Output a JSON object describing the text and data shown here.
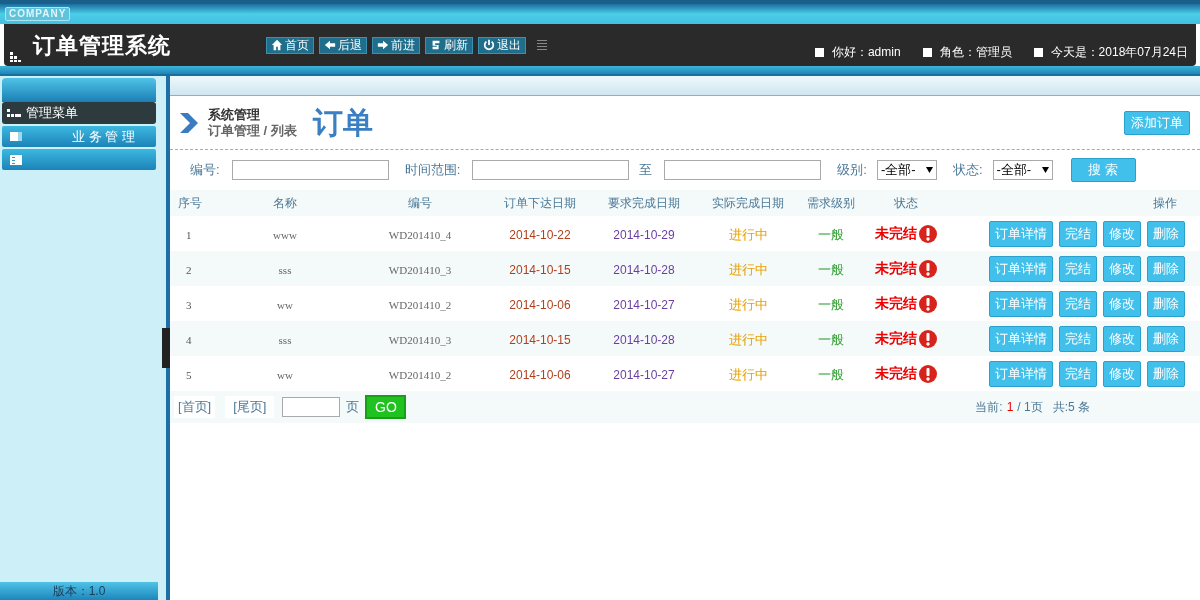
{
  "company": "COMPANY",
  "app_title": "订单管理系统",
  "nav": [
    {
      "kind": "home",
      "label": "首页"
    },
    {
      "kind": "back",
      "label": "后退"
    },
    {
      "kind": "forward",
      "label": "前进"
    },
    {
      "kind": "refresh",
      "label": "刷新"
    },
    {
      "kind": "power",
      "label": "退出"
    }
  ],
  "user_info": [
    "你好：admin",
    "角色：管理员",
    "今天是：2018年07月24日"
  ],
  "sidebar": {
    "title": "管理菜单",
    "items": [
      {
        "kind": "section",
        "label": "业 务 管 理"
      },
      {
        "kind": "blank"
      }
    ],
    "footer": "版本：1.0"
  },
  "breadcrumb": {
    "section": "系统管理",
    "path": "订单管理 / 列表",
    "page_title": "订单"
  },
  "add_button": "添加订单",
  "filters": {
    "fields": [
      {
        "kind": "text",
        "label": "编号:"
      },
      {
        "kind": "text",
        "label": "时间范围:"
      },
      {
        "kind": "text",
        "label": "至"
      },
      {
        "kind": "select",
        "label": "级别:",
        "value": "-全部-"
      },
      {
        "kind": "select",
        "label": "状态:",
        "value": "-全部-"
      }
    ],
    "search_button": "搜 索"
  },
  "table": {
    "columns": [
      "序号",
      "名称",
      "编号",
      "订单下达日期",
      "要求完成日期",
      "实际完成日期",
      "需求级别",
      "状态",
      "操作"
    ],
    "rows": [
      {
        "no": "1",
        "name": "www",
        "code": "WD201410_4",
        "order_date": "2014-10-22",
        "due_date": "2014-10-29",
        "progress": "进行中",
        "level": "一般",
        "status": "未完结",
        "actions": [
          "订单详情",
          "完结",
          "修改",
          "删除"
        ]
      },
      {
        "no": "2",
        "name": "sss",
        "code": "WD201410_3",
        "order_date": "2014-10-15",
        "due_date": "2014-10-28",
        "progress": "进行中",
        "level": "一般",
        "status": "未完结",
        "actions": [
          "订单详情",
          "完结",
          "修改",
          "删除"
        ]
      },
      {
        "no": "3",
        "name": "ww",
        "code": "WD201410_2",
        "order_date": "2014-10-06",
        "due_date": "2014-10-27",
        "progress": "进行中",
        "level": "一般",
        "status": "未完结",
        "actions": [
          "订单详情",
          "完结",
          "修改",
          "删除"
        ]
      },
      {
        "no": "4",
        "name": "sss",
        "code": "WD201410_3",
        "order_date": "2014-10-15",
        "due_date": "2014-10-28",
        "progress": "进行中",
        "level": "一般",
        "status": "未完结",
        "actions": [
          "订单详情",
          "完结",
          "修改",
          "删除"
        ]
      },
      {
        "no": "5",
        "name": "ww",
        "code": "WD201410_2",
        "order_date": "2014-10-06",
        "due_date": "2014-10-27",
        "progress": "进行中",
        "level": "一般",
        "status": "未完结",
        "actions": [
          "订单详情",
          "完结",
          "修改",
          "删除"
        ]
      }
    ]
  },
  "pagination": {
    "first": "[首页]",
    "last": "[尾页]",
    "page_unit": "页",
    "go": "GO",
    "current_label": "当前:",
    "current": "1",
    "total_pages": "/ 1页",
    "total": "共:5 条"
  }
}
